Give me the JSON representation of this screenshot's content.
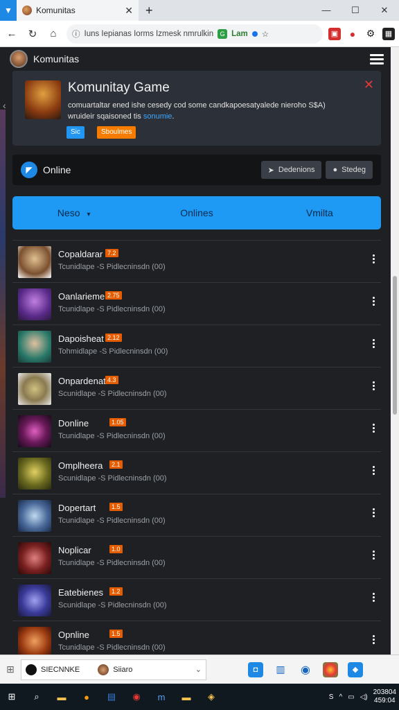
{
  "browser": {
    "tab_title": "Komunitas",
    "new_tab": "+",
    "url": "Iuns Iepianas Iorms Izmesk nmrulkin",
    "omni_badge": "Lam",
    "win": [
      "—",
      "☐",
      "✕"
    ]
  },
  "site": {
    "title": "Komunitas"
  },
  "feature": {
    "title": "Komunitay Game",
    "desc_line1": "comuartaltar ened ishe cesedy cod some candkapoesatyalede nieroho S$A)",
    "desc_line2": "wruideir sqaisoned tis",
    "desc_link": "sonumie",
    "tag1": "Sic",
    "tag2": "Sboulmes"
  },
  "onlinebar": {
    "label": "Online",
    "btn1": "Dedenions",
    "btn2": "Stedeg"
  },
  "tabs": [
    {
      "label": "Neso",
      "caret": "▾"
    },
    {
      "label": "Onlines"
    },
    {
      "label": "Vmilta"
    }
  ],
  "rows": [
    {
      "name": "Copaldarar",
      "badge": "7.2",
      "sub": "Tcunidlape -S Pidlecninsdn (00)",
      "thumb": "#7a5030"
    },
    {
      "name": "Oanlarieme",
      "badge": "2.75",
      "sub": "Tcunidlape -S Pidlecninsdn (00)",
      "thumb": "#5a2a8a"
    },
    {
      "name": "Dapoisheat",
      "badge": "2.12",
      "sub": "Tohmidlape -S Pidlecninsdn (00)",
      "thumb": "#2a7a6a"
    },
    {
      "name": "Onpardenat",
      "badge": "4.3",
      "sub": "Scunidlape -S Pidlecninsdn (00)",
      "thumb": "#8a7a50"
    },
    {
      "name": "Donline",
      "badge": "1.05",
      "sub": "Tcunidlape -S Pidlecninsdn (00)",
      "thumb": "#6a1a5a"
    },
    {
      "name": "Omplheera",
      "badge": "2.1",
      "sub": "Scunidlape -S Pidlecninsdn (00)",
      "thumb": "#6a6a20"
    },
    {
      "name": "Dopertart",
      "badge": "1.5",
      "sub": "Tcunidlape -S Pidlecninsdn (00)",
      "thumb": "#4a6a9a"
    },
    {
      "name": "Noplicar",
      "badge": "1.0",
      "sub": "Tcunidlape -S Pidlecninsdn (00)",
      "thumb": "#7a2020"
    },
    {
      "name": "Eatebienes",
      "badge": "1.2",
      "sub": "Scunidlape -S Pidlecninsdn (00)",
      "thumb": "#3a3a9a"
    },
    {
      "name": "Opnline",
      "badge": "1.5",
      "sub": "Tcunidlape -S Pidlecninsdn (00)",
      "thumb": "#9a3a10"
    }
  ],
  "strip": {
    "search_text": "SIECNNKE",
    "user": "Siiaro"
  },
  "taskbar": {
    "time": "203804",
    "date": "459:04",
    "tray_text": "S"
  }
}
